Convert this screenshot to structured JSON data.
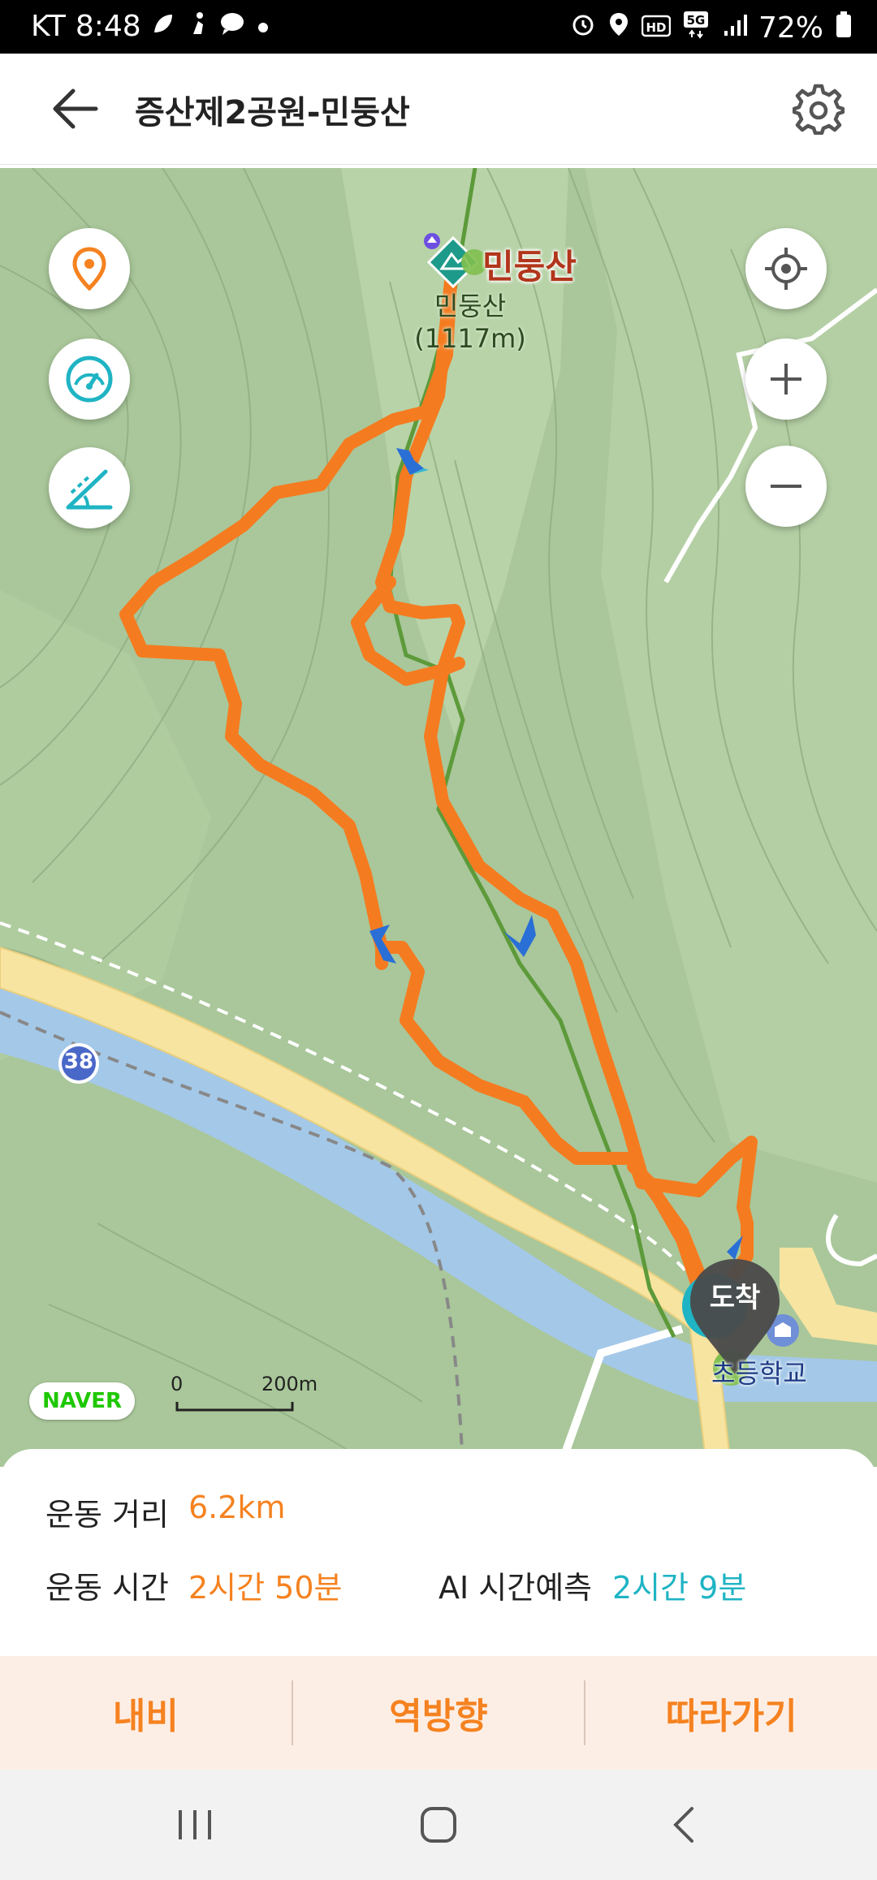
{
  "status_bar": {
    "carrier": "KT",
    "time": "8:48",
    "battery": "72%",
    "network": "5G",
    "icons": [
      "leaf-icon",
      "figure-icon",
      "chat-icon",
      "dot-icon",
      "alarm-icon",
      "location-icon",
      "hd-icon",
      "signal-icon",
      "battery-icon"
    ]
  },
  "app_bar": {
    "title": "증산제2공원-민둥산",
    "back_icon": "back-arrow-icon",
    "settings_icon": "gear-icon"
  },
  "map": {
    "peak_name": "민둥산",
    "peak_label_line1": "민둥산",
    "peak_label_line2": "(1117m)",
    "road_number": "38",
    "naver_logo": "NAVER",
    "scale_zero": "0",
    "scale_distance": "200m",
    "arrive_label": "도착",
    "school_label": "초등학교",
    "colors": {
      "route": "#f57b20",
      "trail": "#5d9a3a",
      "river": "#a4c8e8",
      "road": "#f7e4a0",
      "terrain": "#a9c79a"
    },
    "left_controls": [
      "location-pin-icon",
      "speedometer-icon",
      "slope-icon"
    ],
    "right_controls": [
      "my-location-icon",
      "zoom-in-icon",
      "zoom-out-icon"
    ]
  },
  "summary": {
    "distance_label": "운동 거리",
    "distance_value": "6.2km",
    "time_label": "운동 시간",
    "time_value": "2시간 50분",
    "ai_label": "AI 시간예측",
    "ai_value": "2시간 9분"
  },
  "actions": {
    "navigate": "내비",
    "reverse": "역방향",
    "follow": "따라가기"
  },
  "nav_bar": {
    "recent": "recent-apps-icon",
    "home": "home-icon",
    "back": "back-icon"
  }
}
